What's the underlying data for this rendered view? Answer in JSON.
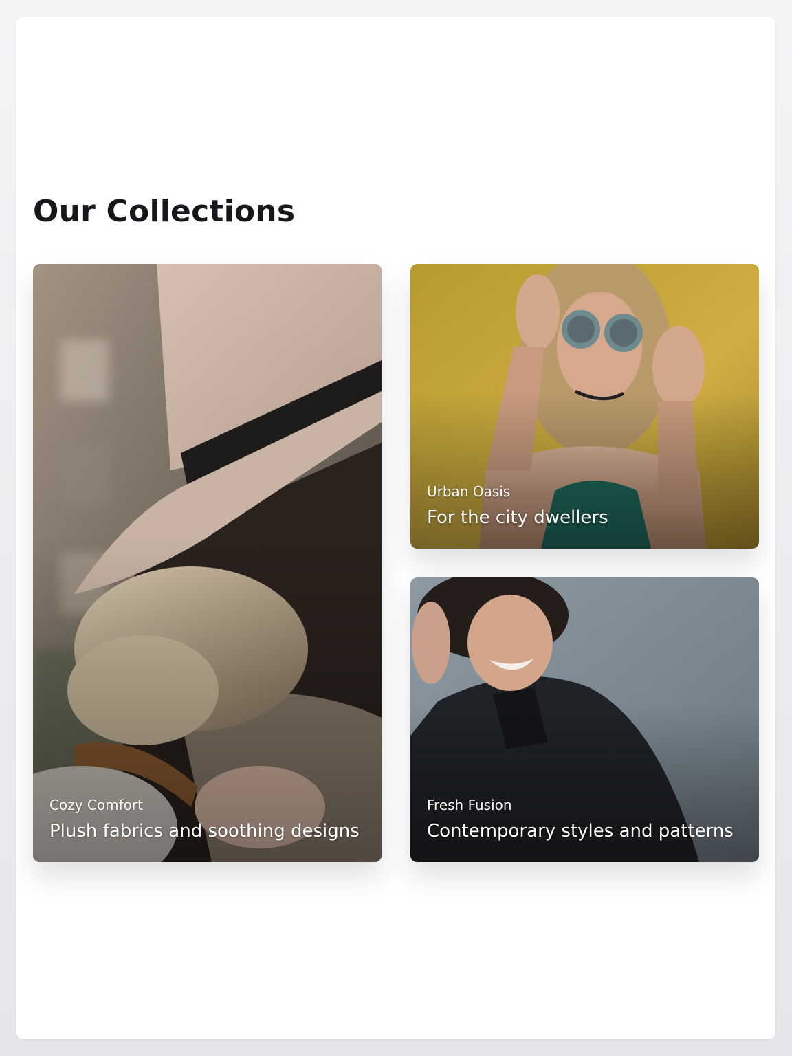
{
  "section": {
    "title": "Our Collections"
  },
  "collections": [
    {
      "name": "Cozy Comfort",
      "tagline": "Plush fabrics and soothing designs",
      "image": "woman-in-felt-hat-photo"
    },
    {
      "name": "Urban Oasis",
      "tagline": "For the city dwellers",
      "image": "woman-with-round-sunglasses-photo"
    },
    {
      "name": "Fresh Fusion",
      "tagline": "Contemporary styles and patterns",
      "image": "laughing-man-in-dark-coat-photo"
    }
  ],
  "colors": {
    "title_text": "#16181c",
    "caption_text": "#ffffff",
    "urban_background": "#c9a93a",
    "fresh_background": "#7f8b94",
    "cozy_hat": "#c9b4a6"
  }
}
